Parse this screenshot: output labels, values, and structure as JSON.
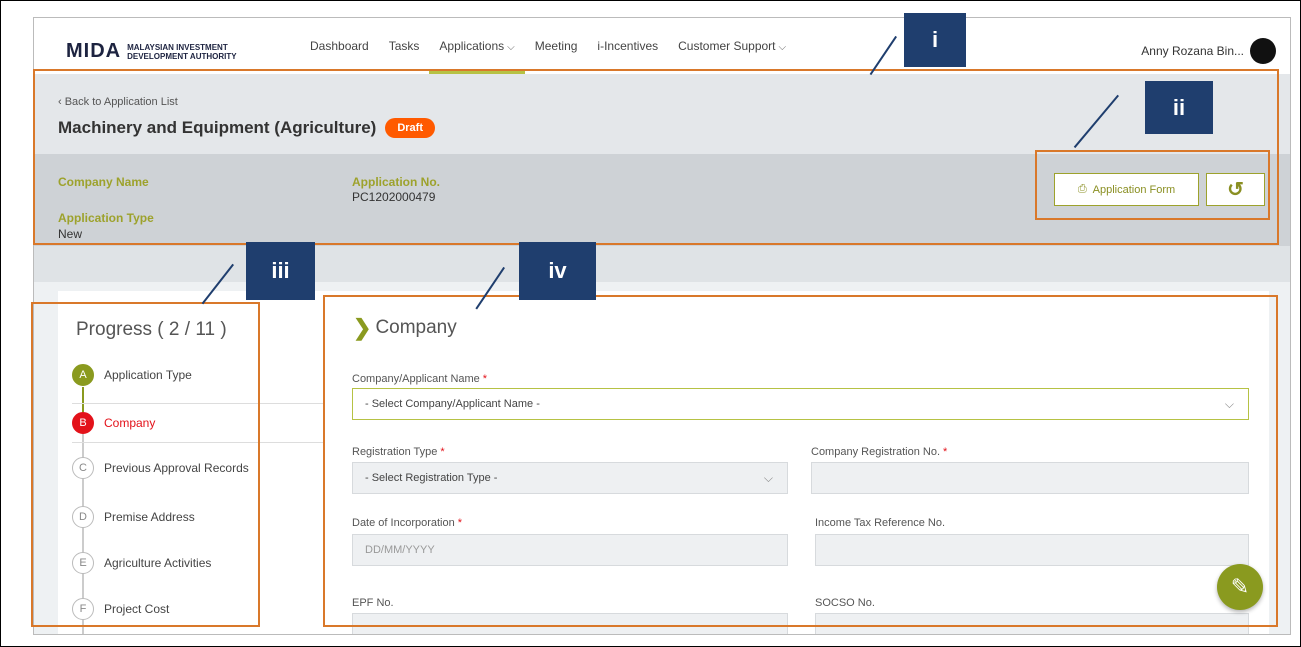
{
  "app": {
    "logo_mark": "MIDA",
    "logo_line1": "MALAYSIAN INVESTMENT",
    "logo_line2": "DEVELOPMENT AUTHORITY"
  },
  "nav": {
    "items": [
      {
        "label": "Dashboard"
      },
      {
        "label": "Tasks"
      },
      {
        "label": "Applications",
        "has_dropdown": true,
        "active": true
      },
      {
        "label": "Meeting"
      },
      {
        "label": "i-Incentives"
      },
      {
        "label": "Customer Support",
        "has_dropdown": true
      }
    ],
    "user_name": "Anny Rozana Bin..."
  },
  "header": {
    "back_link": "‹ Back to Application List",
    "title": "Machinery and Equipment (Agriculture)",
    "status_badge": "Draft",
    "company_name_label": "Company Name",
    "application_no_label": "Application No.",
    "application_no_value": "PC1202000479",
    "application_type_label": "Application Type",
    "application_type_value": "New",
    "application_form_button": "Application Form"
  },
  "progress": {
    "title": "Progress ( 2 / 11 )",
    "steps": [
      {
        "letter": "A",
        "label": "Application Type",
        "state": "done"
      },
      {
        "letter": "B",
        "label": "Company",
        "state": "current"
      },
      {
        "letter": "C",
        "label": "Previous Approval Records",
        "state": "pending"
      },
      {
        "letter": "D",
        "label": "Premise Address",
        "state": "pending"
      },
      {
        "letter": "E",
        "label": "Agriculture Activities",
        "state": "pending"
      },
      {
        "letter": "F",
        "label": "Project Cost",
        "state": "pending"
      }
    ]
  },
  "form": {
    "section_title": "Company",
    "company_name_label": "Company/Applicant Name",
    "company_name_value": "- Select Company/Applicant Name -",
    "registration_type_label": "Registration Type",
    "registration_type_value": "- Select Registration Type -",
    "company_reg_no_label": "Company Registration No.",
    "date_of_incorporation_label": "Date of Incorporation",
    "date_of_incorporation_placeholder": "DD/MM/YYYY",
    "income_tax_label": "Income Tax Reference No.",
    "epf_label": "EPF No.",
    "socso_label": "SOCSO No."
  },
  "callouts": {
    "i": "i",
    "ii": "ii",
    "iii": "iii",
    "iv": "iv"
  },
  "colors": {
    "accent_green": "#8a9a1f",
    "draft_orange": "#ff5a00",
    "current_step_red": "#e3121a",
    "callout_orange": "#d9782a",
    "callout_navy": "#1f3e6e"
  }
}
